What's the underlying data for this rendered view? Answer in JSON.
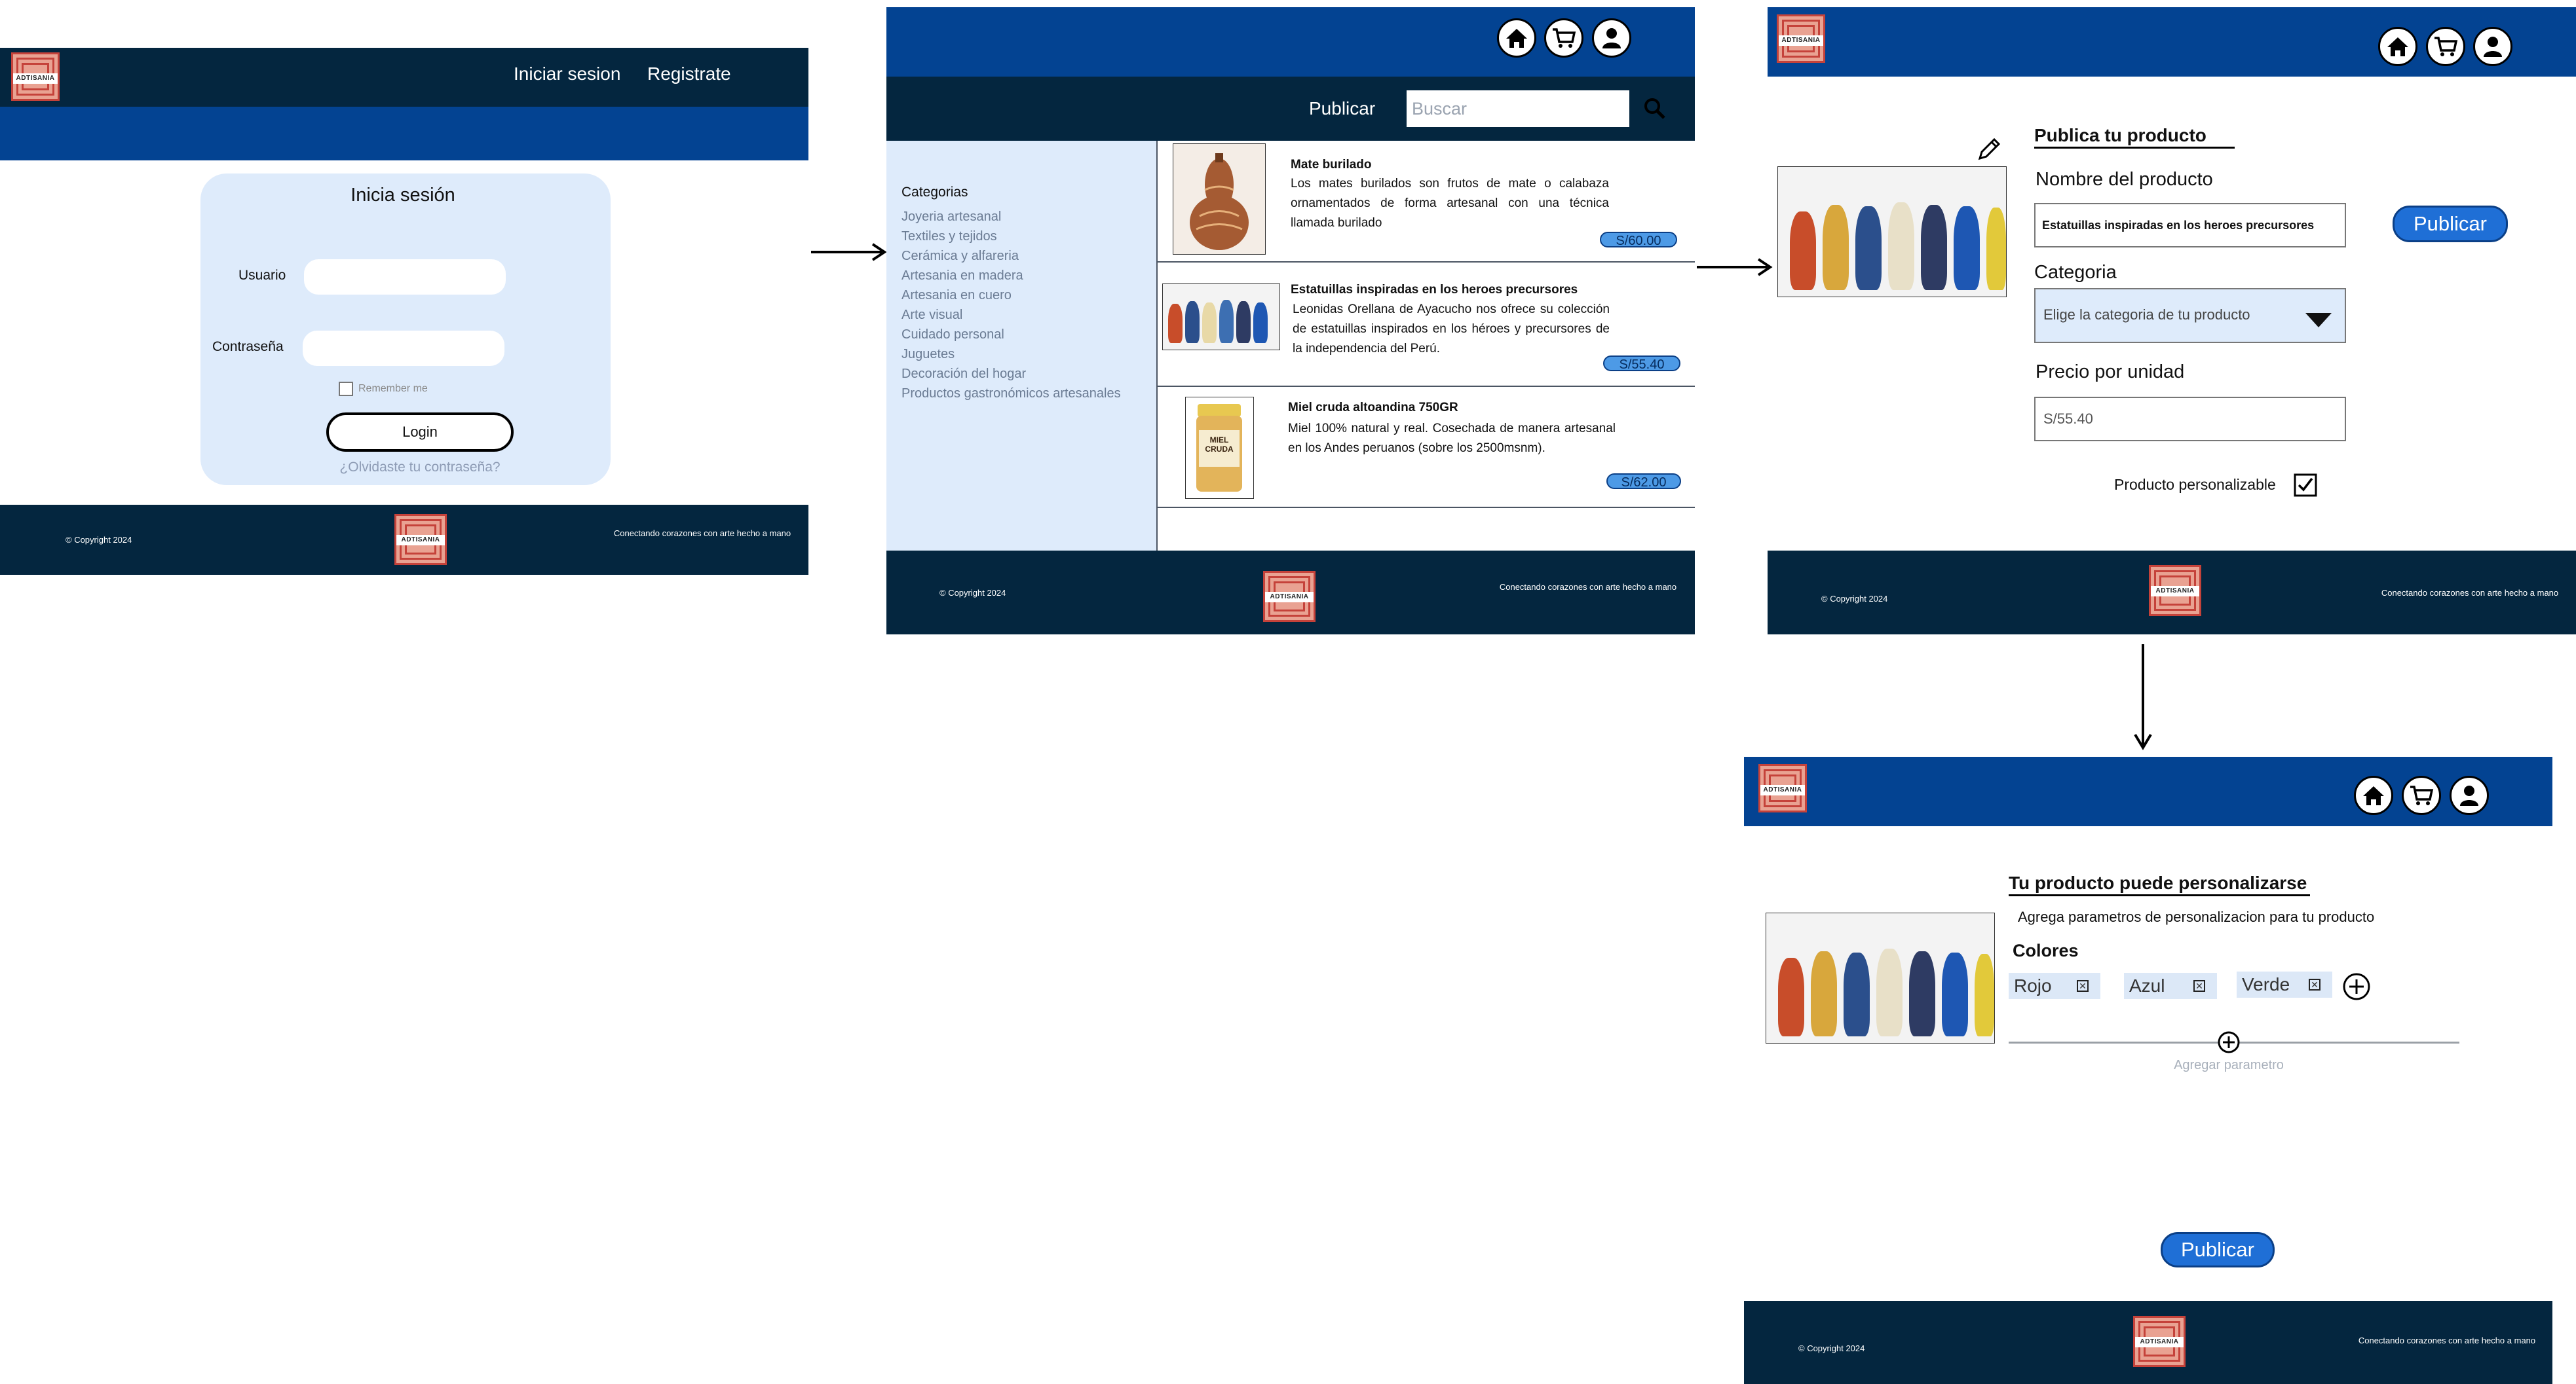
{
  "brand": {
    "logo_text": "ADTISANIA",
    "colors": {
      "dark_navy": "#04263f",
      "blue": "#034392",
      "light_panel": "#deebfb",
      "price_badge": "#4d9ae6",
      "publish_button": "#1f6fd6"
    }
  },
  "icons": [
    "home-icon",
    "cart-icon",
    "user-icon",
    "search-icon",
    "pencil-icon",
    "dropdown-icon",
    "checkbox-icon",
    "plus-circle-icon",
    "close-box-icon",
    "arrow-right-icon",
    "arrow-down-icon"
  ],
  "footer": {
    "copyright": "© Copyright 2024",
    "tagline": "Conectando corazones con arte hecho a mano"
  },
  "login_screen": {
    "nav": {
      "login": "Iniciar sesion",
      "register": "Registrate"
    },
    "card_title": "Inicia sesión",
    "user_label": "Usuario",
    "user_value": "",
    "password_label": "Contraseña",
    "password_value": "",
    "remember_me": "Remember me",
    "login_button": "Login",
    "forgot_password": "¿Olvidaste tu contraseña?"
  },
  "catalog_screen": {
    "publish_link": "Publicar",
    "search_placeholder": "Buscar",
    "categories_title": "Categorias",
    "categories": [
      "Joyeria artesanal",
      "Textiles y tejidos",
      "Cerámica y alfareria",
      "Artesania en madera",
      "Artesania en cuero",
      "Arte visual",
      "Cuidado personal",
      "Juguetes",
      "Decoración del hogar",
      "Productos gastronómicos artesanales"
    ],
    "products": [
      {
        "title": "Mate burilado",
        "description": "Los mates burilados son frutos de mate o calabaza ornamentados de forma artesanal con una técnica llamada burilado",
        "price": "S/60.00"
      },
      {
        "title": "Estatuillas inspiradas en los heroes precursores",
        "description": "Leonidas Orellana de Ayacucho nos ofrece su colección de estatuillas inspirados en los héroes y precursores de la independencia del Perú.",
        "price": "S/55.40"
      },
      {
        "title": "Miel cruda altoandina 750GR",
        "description": "Miel 100% natural y real. Cosechada de manera artesanal en los Andes peruanos (sobre los 2500msnm).",
        "price": "S/62.00",
        "jar_label": "MIEL CRUDA"
      }
    ]
  },
  "publish_screen": {
    "title": "Publica tu producto",
    "name_label": "Nombre del producto",
    "name_value": "Estatuillas inspiradas en los heroes precursores",
    "publish_button": "Publicar",
    "category_label": "Categoria",
    "category_placeholder": "Elige la categoria de tu producto",
    "price_label": "Precio por unidad",
    "price_value": "S/55.40",
    "customizable_label": "Producto personalizable",
    "customizable_checked": true
  },
  "customize_screen": {
    "title": "Tu producto puede personalizarse",
    "subtitle": "Agrega parametros de personalizacion para tu producto",
    "param_name": "Colores",
    "options": [
      "Rojo",
      "Azul",
      "Verde"
    ],
    "add_parameter": "Agregar parametro",
    "publish_button": "Publicar"
  }
}
